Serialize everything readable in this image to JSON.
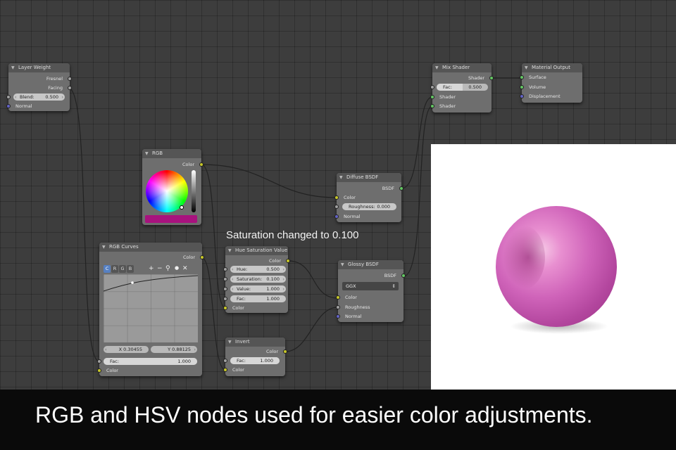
{
  "nodes": {
    "layer_weight": {
      "title": "Layer Weight",
      "out_fresnel": "Fresnel",
      "out_facing": "Facing",
      "blend_label": "Blend:",
      "blend_value": "0.500",
      "in_normal": "Normal"
    },
    "rgb": {
      "title": "RGB",
      "out_color": "Color",
      "swatch_color": "#a8127e"
    },
    "rgb_curves": {
      "title": "RGB Curves",
      "out_color": "Color",
      "tabs": [
        "C",
        "R",
        "G",
        "B"
      ],
      "tool_icons": [
        "+",
        "−",
        "⚲",
        "●",
        "✕"
      ],
      "x_value": "X 0.30455",
      "y_value": "Y 0.88125",
      "fac_label": "Fac:",
      "fac_value": "1.000",
      "in_color": "Color"
    },
    "hue_sat": {
      "title": "Hue Saturation Value",
      "out_color": "Color",
      "hue_label": "Hue:",
      "hue_value": "0.500",
      "sat_label": "Saturation:",
      "sat_value": "0.100",
      "val_label": "Value:",
      "val_value": "1.000",
      "fac_label": "Fac:",
      "fac_value": "1.000",
      "in_color": "Color"
    },
    "invert": {
      "title": "Invert",
      "out_color": "Color",
      "fac_label": "Fac:",
      "fac_value": "1.000",
      "in_color": "Color"
    },
    "diffuse": {
      "title": "Diffuse BSDF",
      "out_bsdf": "BSDF",
      "in_color": "Color",
      "rough_label": "Roughness:",
      "rough_value": "0.000",
      "in_normal": "Normal"
    },
    "glossy": {
      "title": "Glossy BSDF",
      "out_bsdf": "BSDF",
      "distribution": "GGX",
      "in_color": "Color",
      "in_roughness": "Roughness",
      "in_normal": "Normal"
    },
    "mix": {
      "title": "Mix Shader",
      "out_shader": "Shader",
      "fac_label": "Fac:",
      "fac_value": "0.500",
      "in_shader1": "Shader",
      "in_shader2": "Shader"
    },
    "output": {
      "title": "Material Output",
      "in_surface": "Surface",
      "in_volume": "Volume",
      "in_displacement": "Displacement"
    }
  },
  "overlay_text": "Saturation changed to 0.100",
  "caption": "RGB and HSV nodes used for easier color adjustments.",
  "colors": {
    "sphere": "#d466b8",
    "socket_color": "#c7c729",
    "socket_shader": "#63c763",
    "socket_value": "#a1a1a1",
    "socket_vector": "#6363c7"
  }
}
